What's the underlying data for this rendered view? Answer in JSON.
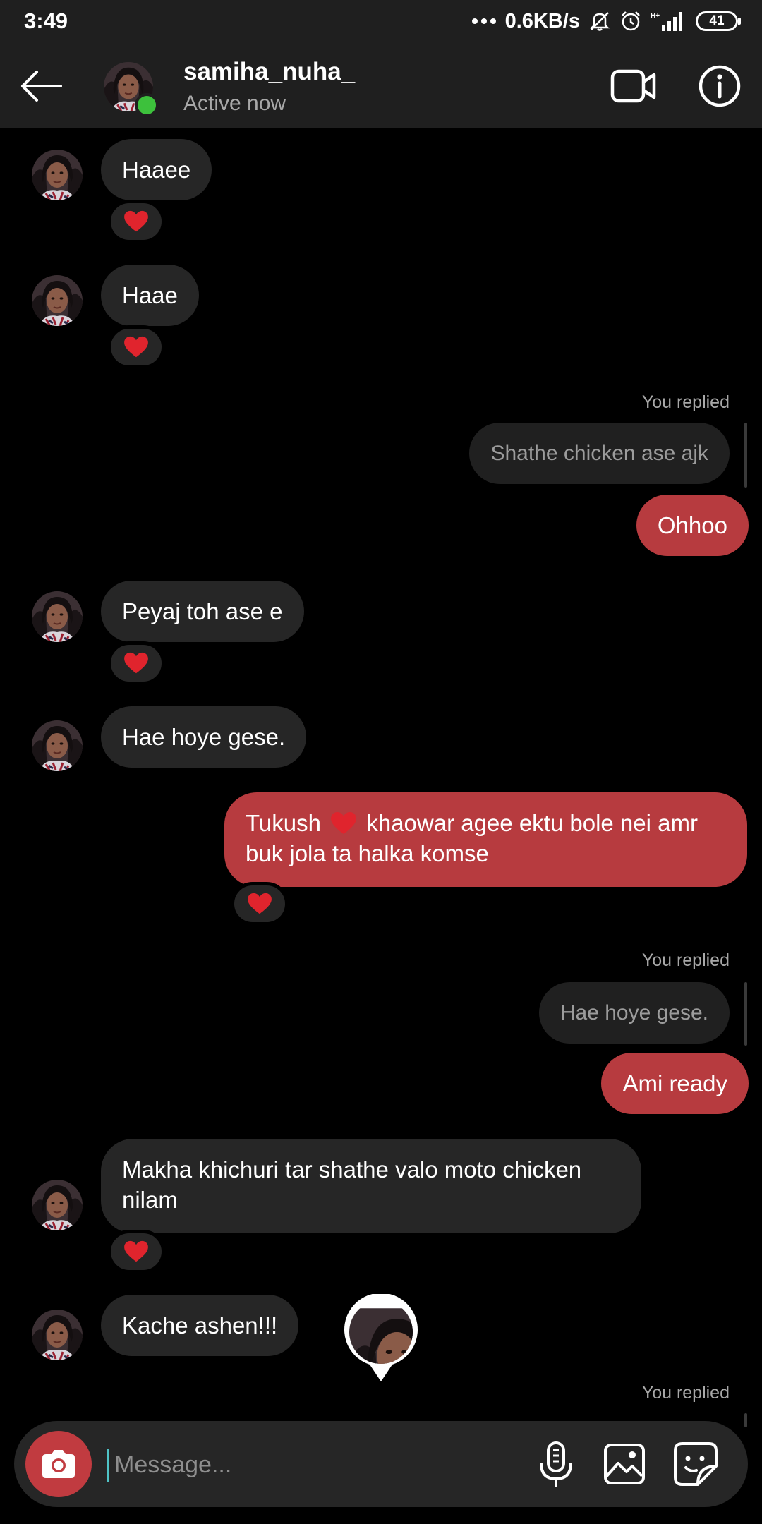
{
  "status_bar": {
    "time": "3:49",
    "network_speed": "0.6KB/s",
    "battery": "41",
    "icons": [
      "dots-icon",
      "mute-icon",
      "alarm-icon",
      "signal-icon",
      "battery-icon"
    ]
  },
  "header": {
    "username": "samiha_nuha_",
    "status": "Active now",
    "online_color": "#3dc13c"
  },
  "messages": {
    "m1": {
      "text": "Haaee",
      "reaction": "heart"
    },
    "m2": {
      "text": "Haae",
      "reaction": "heart"
    },
    "r1": {
      "label": "You replied",
      "quoted": "Shathe chicken ase ajk",
      "text": "Ohhoo"
    },
    "m3": {
      "text": "Peyaj toh ase e",
      "reaction": "heart"
    },
    "m4": {
      "text": "Hae hoye gese."
    },
    "m5": {
      "text_before": "Tukush",
      "text_after": "khaowar agee ektu bole nei amr buk jola ta halka komse",
      "reaction": "heart"
    },
    "r2": {
      "label": "You replied",
      "quoted": "Hae hoye gese.",
      "text": "Ami ready"
    },
    "m6": {
      "text": "Makha khichuri tar shathe valo moto chicken nilam",
      "reaction": "heart"
    },
    "m7": {
      "text": "Kache ashen!!!"
    },
    "r3": {
      "label": "You replied"
    }
  },
  "composer": {
    "placeholder": "Message..."
  },
  "colors": {
    "outgoing_bubble": "#b73b3f",
    "incoming_bubble": "#262626",
    "heart": "#e0242d",
    "camera_button": "#c13b40"
  }
}
